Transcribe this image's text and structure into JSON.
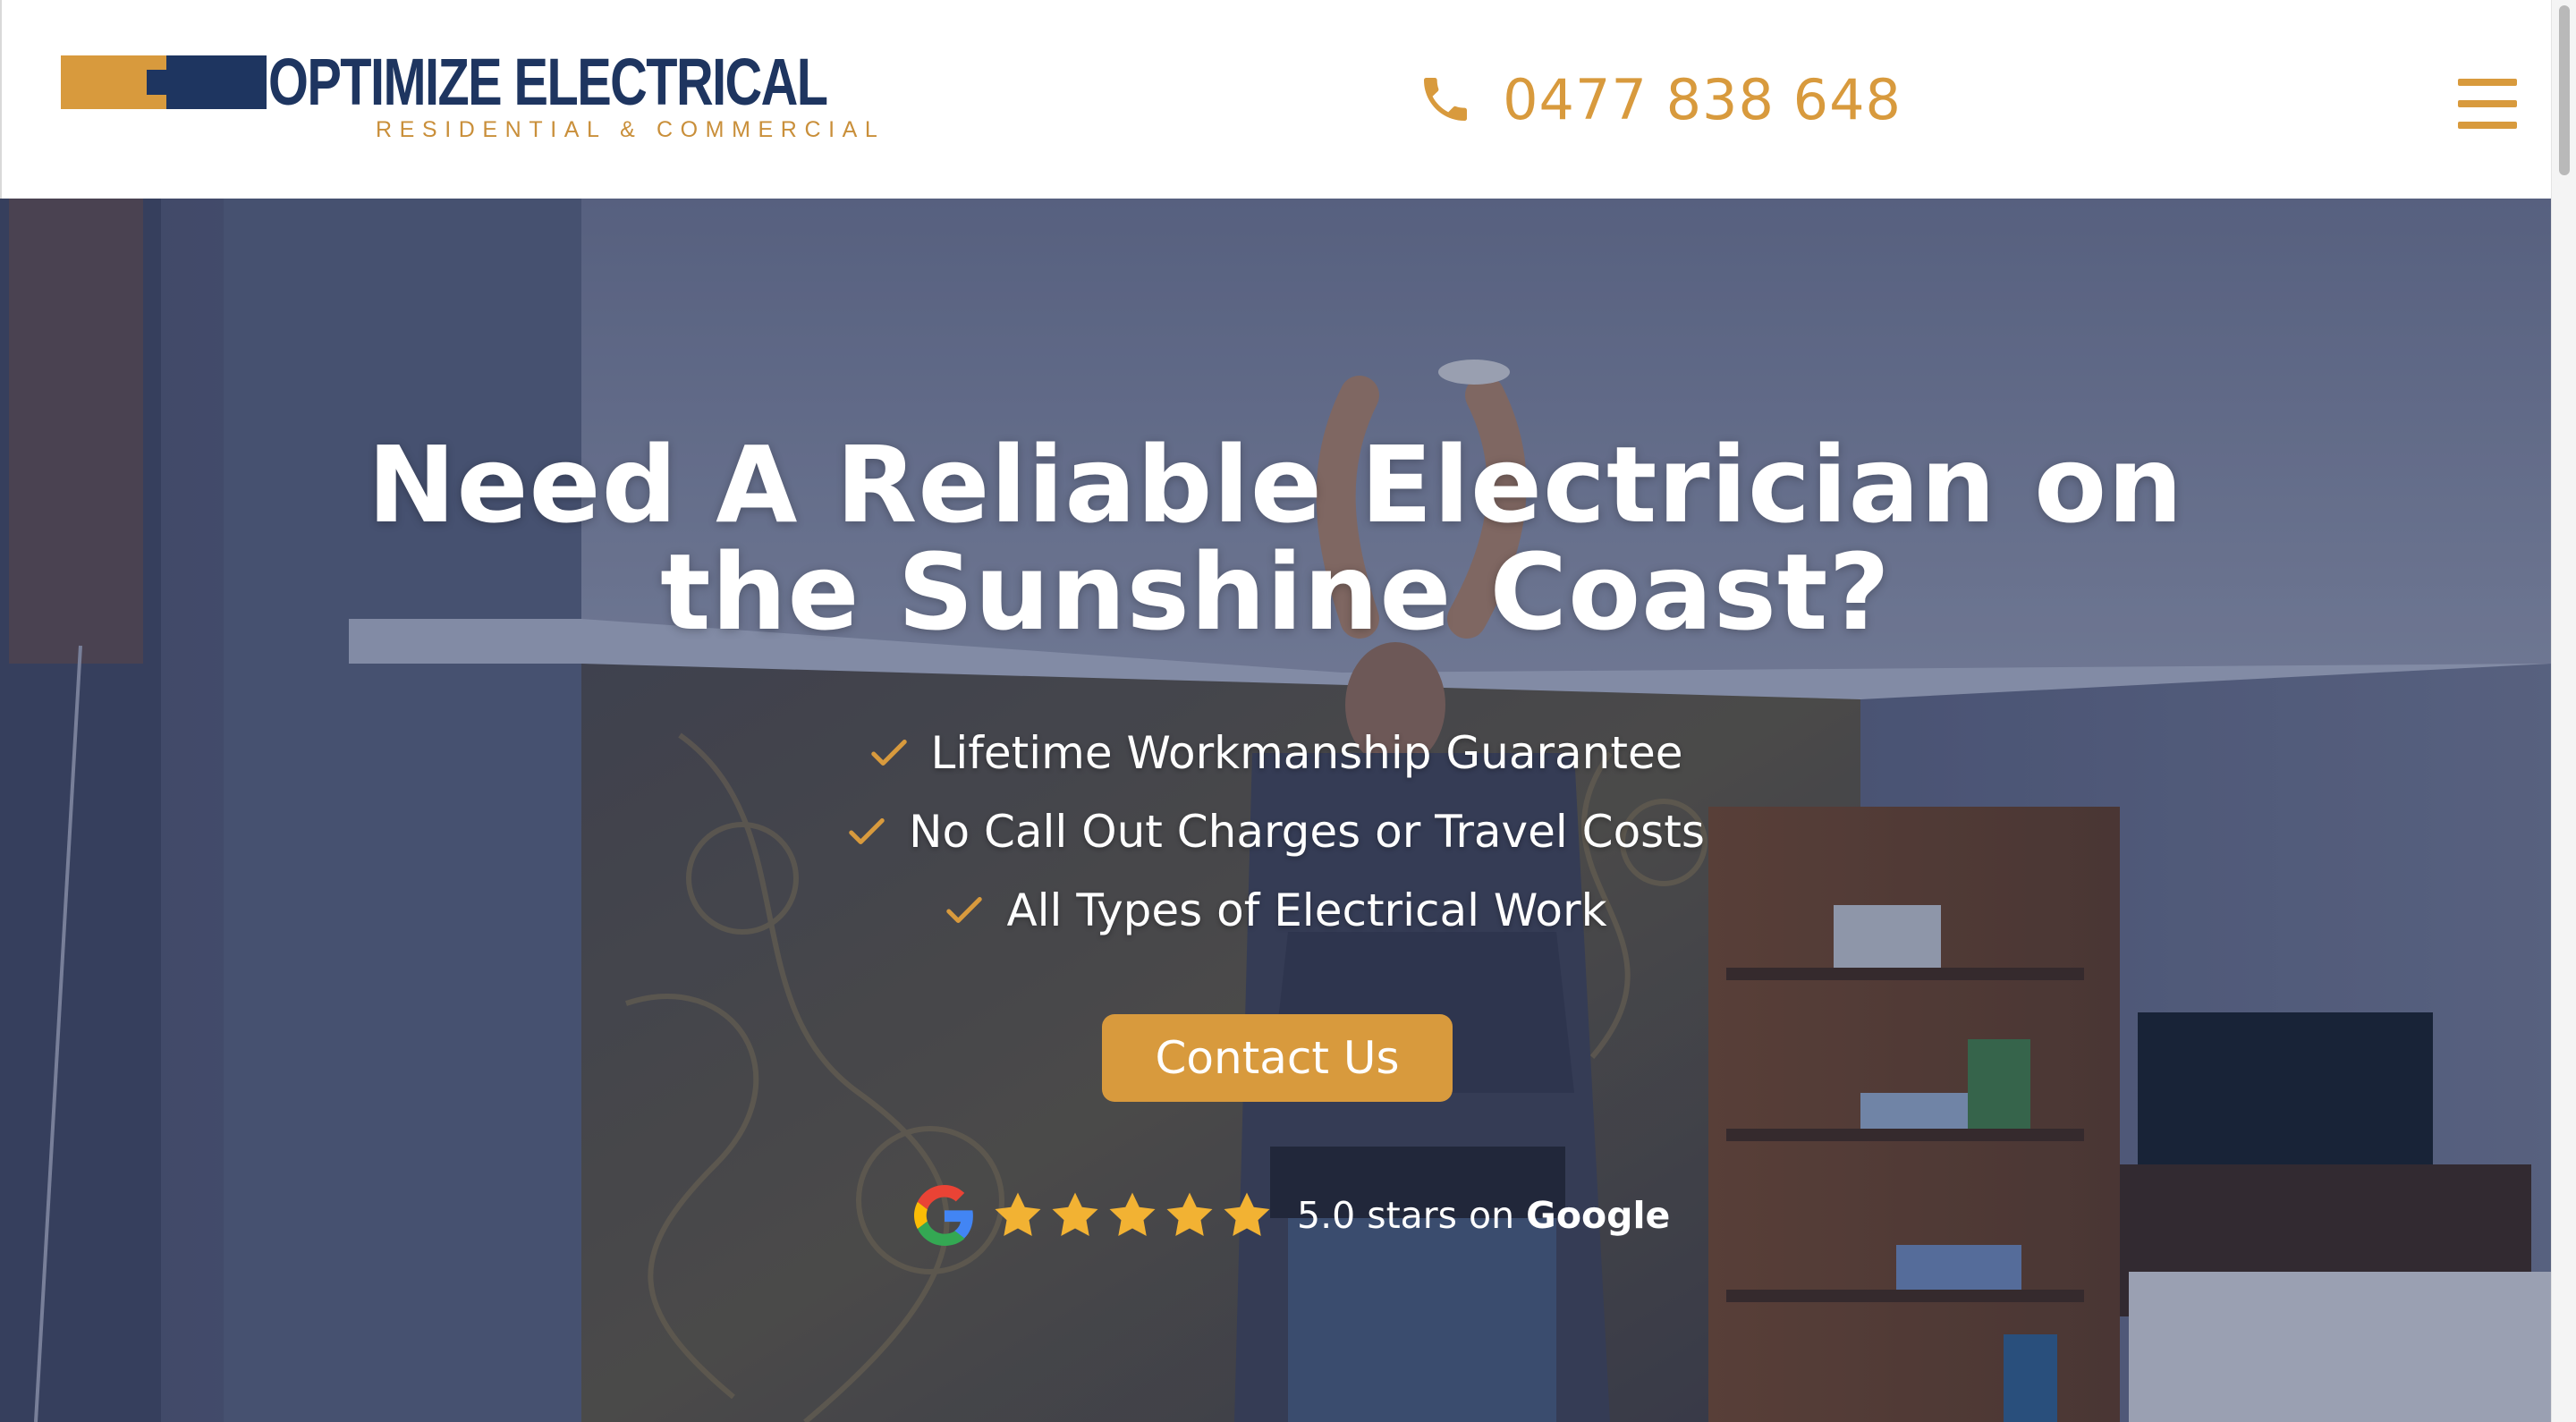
{
  "header": {
    "logo": {
      "wordmark": "OPTIMIZE ELECTRICAL",
      "tagline": "RESIDENTIAL & COMMERCIAL"
    },
    "phone": {
      "number": "0477 838 648",
      "icon": "phone-icon"
    },
    "menu_icon": "hamburger-menu-icon"
  },
  "hero": {
    "title_line1": "Need A Reliable Electrician on",
    "title_line2": "the Sunshine Coast?",
    "features": [
      "Lifetime Workmanship Guarantee",
      "No Call Out Charges or Travel Costs",
      "All Types of Electrical Work"
    ],
    "cta_label": "Contact Us",
    "rating": {
      "stars": 5,
      "text_prefix": "5.0 stars on",
      "text_brand": "Google"
    },
    "background": "photo of electrician installing a ceiling light"
  },
  "colors": {
    "accent": "#d89a3d",
    "brand_navy": "#1e3560",
    "text_light": "#ffffff"
  }
}
